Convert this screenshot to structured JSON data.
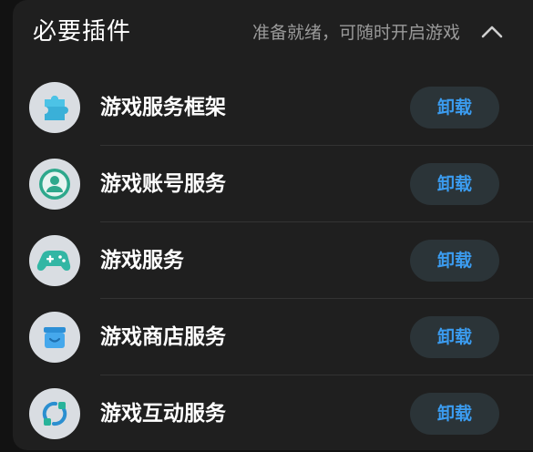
{
  "header": {
    "title": "必要插件",
    "subtitle": "准备就绪，可随时开启游戏",
    "collapse_icon": "chevron-up-icon"
  },
  "plugins": [
    {
      "name": "游戏服务框架",
      "icon": "puzzle-icon",
      "action": "卸载"
    },
    {
      "name": "游戏账号服务",
      "icon": "user-account-icon",
      "action": "卸载"
    },
    {
      "name": "游戏服务",
      "icon": "gamepad-icon",
      "action": "卸载"
    },
    {
      "name": "游戏商店服务",
      "icon": "store-icon",
      "action": "卸载"
    },
    {
      "name": "游戏互动服务",
      "icon": "interaction-icon",
      "action": "卸载"
    }
  ],
  "colors": {
    "background": "#121212",
    "card": "#1f1f1f",
    "button_bg": "#2b3438",
    "button_text": "#3b9cf0",
    "subtitle": "#9a9a9a"
  }
}
